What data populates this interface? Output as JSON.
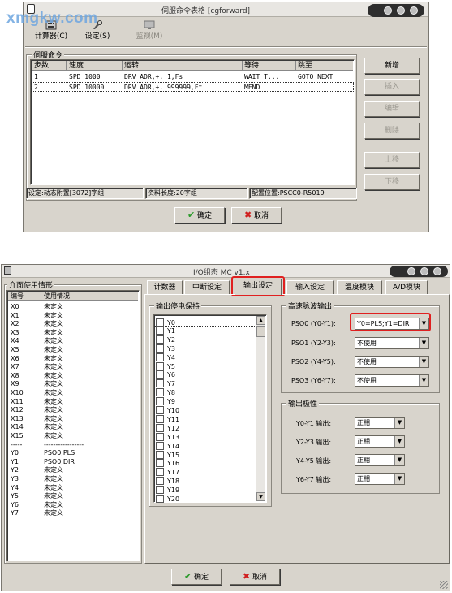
{
  "watermark": "xmgkw.com",
  "top_window": {
    "title": "伺服命令表格 [cgforward]",
    "toolbar": [
      {
        "label": "计算器(C)",
        "icon": "calculator-icon"
      },
      {
        "label": "设定(S)",
        "icon": "settings-icon"
      },
      {
        "label": "监视(M)",
        "icon": "monitor-icon"
      }
    ],
    "group_title": "伺服命令",
    "columns": [
      "步数",
      "速度",
      "运转",
      "等待",
      "跳至"
    ],
    "rows": [
      {
        "step": "1",
        "speed": "SPD  1000",
        "run": "DRV  ADR,+,  1,Fs",
        "wait": "WAIT  T...",
        "jump": "GOTO  NEXT"
      },
      {
        "step": "2",
        "speed": "SPD  10000",
        "run": "DRV  ADR,+,  999999,Ft",
        "wait": "MEND",
        "jump": ""
      }
    ],
    "side_buttons": [
      "新增",
      "插入",
      "编辑",
      "删除",
      "上移",
      "下移"
    ],
    "status": {
      "setting": "设定:动态附置[3072]字组",
      "length": "资料长度:20字组",
      "position": "配置位置:PSCC0-R5019"
    },
    "ok_label": "确定",
    "cancel_label": "取消"
  },
  "bottom_window": {
    "title": "I/O组态 MC v1.x",
    "usage_group": "介面使用情形",
    "usage_columns": [
      "编号",
      "使用情况"
    ],
    "usage_rows": [
      {
        "id": "X0",
        "status": "未定义"
      },
      {
        "id": "X1",
        "status": "未定义"
      },
      {
        "id": "X2",
        "status": "未定义"
      },
      {
        "id": "X3",
        "status": "未定义"
      },
      {
        "id": "X4",
        "status": "未定义"
      },
      {
        "id": "X5",
        "status": "未定义"
      },
      {
        "id": "X6",
        "status": "未定义"
      },
      {
        "id": "X7",
        "status": "未定义"
      },
      {
        "id": "X8",
        "status": "未定义"
      },
      {
        "id": "X9",
        "status": "未定义"
      },
      {
        "id": "X10",
        "status": "未定义"
      },
      {
        "id": "X11",
        "status": "未定义"
      },
      {
        "id": "X12",
        "status": "未定义"
      },
      {
        "id": "X13",
        "status": "未定义"
      },
      {
        "id": "X14",
        "status": "未定义"
      },
      {
        "id": "X15",
        "status": "未定义"
      },
      {
        "id": "-----",
        "status": "-----------------"
      },
      {
        "id": "Y0",
        "status": "PSO0,PLS"
      },
      {
        "id": "Y1",
        "status": "PSO0,DIR"
      },
      {
        "id": "Y2",
        "status": "未定义"
      },
      {
        "id": "Y3",
        "status": "未定义"
      },
      {
        "id": "Y4",
        "status": "未定义"
      },
      {
        "id": "Y5",
        "status": "未定义"
      },
      {
        "id": "Y6",
        "status": "未定义"
      },
      {
        "id": "Y7",
        "status": "未定义"
      }
    ],
    "tabs": [
      "计数器",
      "中断设定",
      "输出设定",
      "输入设定",
      "温度模块",
      "A/D模块"
    ],
    "hold_group": "输出停电保持",
    "hold_items": [
      "Y0",
      "Y1",
      "Y2",
      "Y3",
      "Y4",
      "Y5",
      "Y6",
      "Y7",
      "Y8",
      "Y9",
      "Y10",
      "Y11",
      "Y12",
      "Y13",
      "Y14",
      "Y15",
      "Y16",
      "Y17",
      "Y18",
      "Y19",
      "Y20"
    ],
    "pulse_group": "高速脉波输出",
    "pulse_rows": [
      {
        "label": "PSO0 (Y0-Y1):",
        "value": "Y0=PLS;Y1=DIR"
      },
      {
        "label": "PSO1 (Y2-Y3):",
        "value": "不使用"
      },
      {
        "label": "PSO2 (Y4-Y5):",
        "value": "不使用"
      },
      {
        "label": "PSO3 (Y6-Y7):",
        "value": "不使用"
      }
    ],
    "polarity_group": "输出极性",
    "polarity_rows": [
      {
        "label": "Y0-Y1 输出:",
        "value": "正相"
      },
      {
        "label": "Y2-Y3 输出:",
        "value": "正相"
      },
      {
        "label": "Y4-Y5 输出:",
        "value": "正相"
      },
      {
        "label": "Y6-Y7 输出:",
        "value": "正相"
      }
    ],
    "ok_label": "确定",
    "cancel_label": "取消"
  },
  "colors": {
    "highlight": "#e02020",
    "ok_check": "#2a9a2a",
    "cancel_x": "#d02020"
  }
}
